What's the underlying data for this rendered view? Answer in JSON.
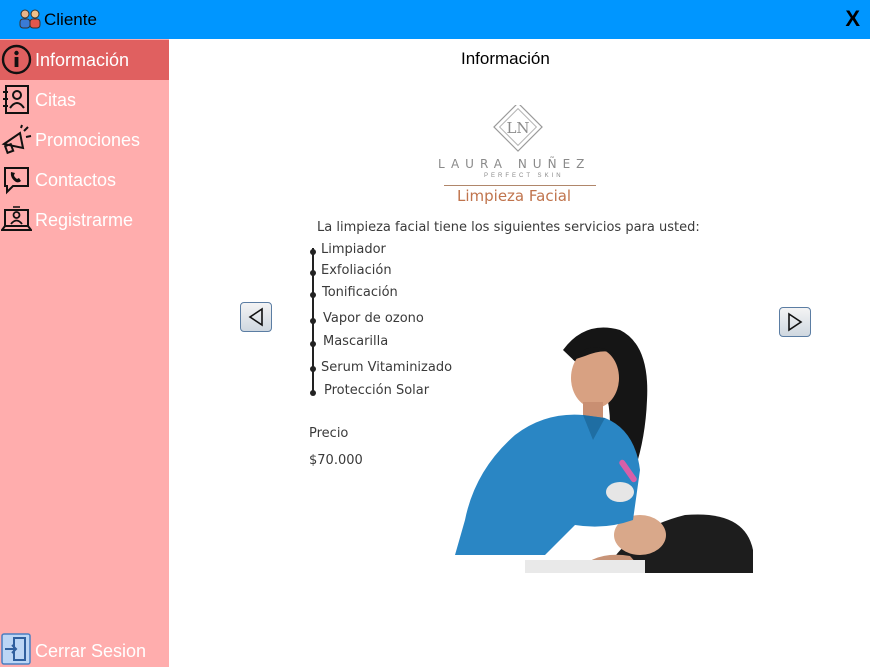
{
  "window": {
    "title": "Cliente",
    "close_label": "X"
  },
  "sidebar": {
    "items": [
      {
        "label": "Información",
        "icon": "info-icon",
        "active": true
      },
      {
        "label": "Citas",
        "icon": "contact-book-icon",
        "active": false
      },
      {
        "label": "Promociones",
        "icon": "megaphone-icon",
        "active": false
      },
      {
        "label": "Contactos",
        "icon": "phone-icon",
        "active": false
      },
      {
        "label": "Registrarme",
        "icon": "laptop-user-icon",
        "active": false
      }
    ],
    "logout_label": "Cerrar Sesion"
  },
  "main": {
    "title": "Información",
    "card": {
      "brand": "LAURA NUÑEZ",
      "brand_monogram": "LN",
      "tagline": "PERFECT SKIN",
      "service_title": "Limpieza Facial",
      "intro": "La limpieza facial tiene los siguientes servicios para usted:",
      "services": [
        "Limpiador",
        "Exfoliación",
        "Tonificación",
        "Vapor de ozono",
        "Mascarilla",
        "Serum Vitaminizado",
        "Protección Solar"
      ],
      "price_label": "Precio",
      "price_value": "$70.000"
    }
  },
  "colors": {
    "titlebar": "#0096ff",
    "sidebar": "#ffadad",
    "sidebar_active": "#e06060",
    "accent_brown": "#c0744d"
  }
}
